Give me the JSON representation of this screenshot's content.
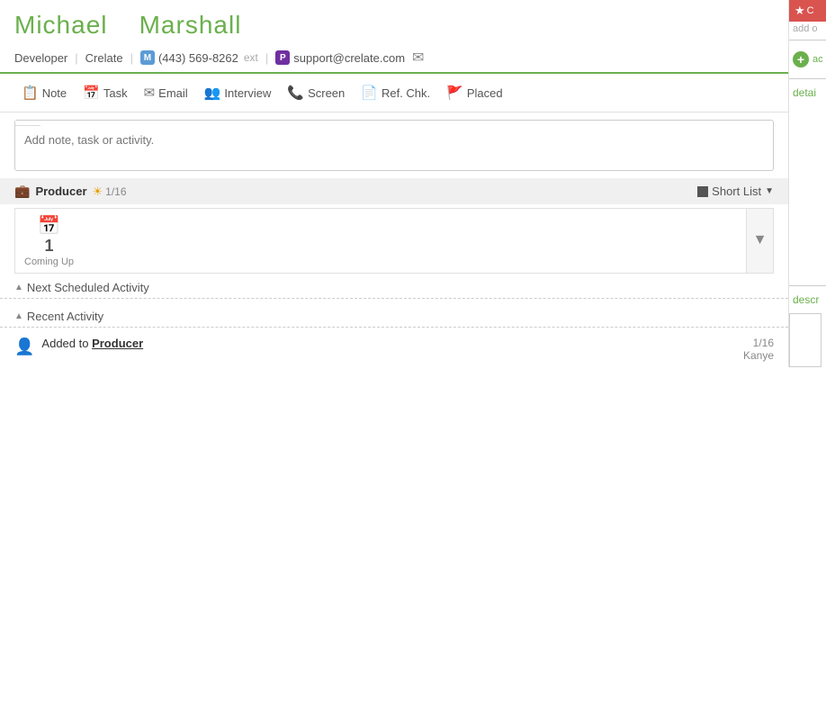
{
  "header": {
    "first_name": "Michael",
    "last_name": "Marshall",
    "title": "Developer",
    "company": "Crelate",
    "phone_badge": "M",
    "phone": "(443) 569-8262",
    "ext_label": "ext",
    "email_badge": "P",
    "email": "support@crelate.com"
  },
  "toolbar": {
    "note_label": "Note",
    "task_label": "Task",
    "email_label": "Email",
    "interview_label": "Interview",
    "screen_label": "Screen",
    "refchk_label": "Ref. Chk.",
    "placed_label": "Placed"
  },
  "note_input": {
    "placeholder": "Add note, task or activity."
  },
  "pipeline": {
    "name": "Producer",
    "date": "1/16",
    "shortlist_label": "Short List"
  },
  "coming_up": {
    "count": "1",
    "label": "Coming Up"
  },
  "next_scheduled": {
    "header": "Next Scheduled Activity"
  },
  "recent_activity": {
    "header": "Recent Activity",
    "items": [
      {
        "text": "Added to ",
        "link": "Producer",
        "date": "1/16",
        "user": "Kanye"
      }
    ]
  },
  "sidebar": {
    "star_label": "C",
    "add_label": "ac",
    "detail_label": "detai",
    "add_icon": "+",
    "descr_label": "descr"
  }
}
